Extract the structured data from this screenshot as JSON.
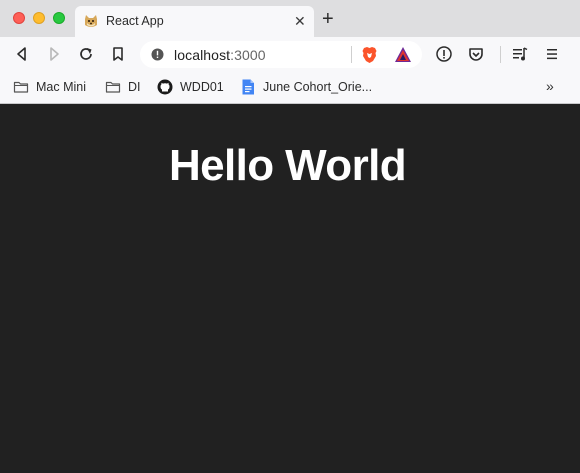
{
  "browser": {
    "tab": {
      "title": "React App",
      "favicon": "doge-icon"
    },
    "address": {
      "host": "localhost",
      "port": ":3000"
    },
    "bookmarks": [
      {
        "label": "Mac Mini",
        "icon": "folder-icon"
      },
      {
        "label": "DI",
        "icon": "folder-icon"
      },
      {
        "label": "WDD01",
        "icon": "github-icon"
      },
      {
        "label": "June Cohort_Orie...",
        "icon": "google-docs-icon"
      }
    ],
    "bookmarks_more": "»"
  },
  "page": {
    "heading": "Hello World",
    "background": "#212121",
    "text_color": "#ffffff"
  },
  "colors": {
    "tab_strip": "#dedee0",
    "toolbar": "#f8f8fa",
    "brave_orange": "#fb542b",
    "docs_blue": "#4285f4"
  }
}
